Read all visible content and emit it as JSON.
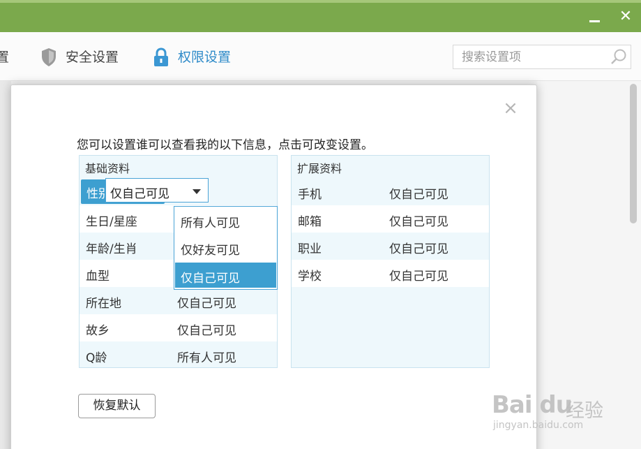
{
  "titlebar": {
    "minimize_icon": "minimize-icon",
    "close_glyph": "✕"
  },
  "nav": {
    "prev_tail": "置",
    "security_label": "安全设置",
    "permission_label": "权限设置",
    "security_icon": "shield-icon",
    "permission_icon": "lock-icon"
  },
  "search": {
    "placeholder": "搜索设置项",
    "icon": "search-icon"
  },
  "dialog": {
    "close_glyph": "×",
    "intro": "您可以设置谁可以查看我的以下信息，点击可改变设置。",
    "basic": {
      "title": "基础资料",
      "rows": [
        {
          "key": "性别",
          "value": "仅自己可见"
        },
        {
          "key": "生日/星座",
          "value": ""
        },
        {
          "key": "年龄/生肖",
          "value": ""
        },
        {
          "key": "血型",
          "value": ""
        },
        {
          "key": "所在地",
          "value": "仅自己可见"
        },
        {
          "key": "故乡",
          "value": "仅自己可见"
        },
        {
          "key": "Q龄",
          "value": "所有人可见"
        }
      ]
    },
    "select": {
      "current": "仅自己可见",
      "options": [
        "所有人可见",
        "仅好友可见",
        "仅自己可见"
      ],
      "selected_index": 2
    },
    "extended": {
      "title": "扩展资料",
      "rows": [
        {
          "key": "手机",
          "value": "仅自己可见"
        },
        {
          "key": "邮箱",
          "value": "仅自己可见"
        },
        {
          "key": "职业",
          "value": "仅自己可见"
        },
        {
          "key": "学校",
          "value": "仅自己可见"
        }
      ]
    },
    "restore_button": "恢复默认"
  },
  "watermark": {
    "brand": "Bai du",
    "label": "经验",
    "url": "jingyan.baidu.com"
  },
  "colors": {
    "titlebar_green": "#7ba94c",
    "accent_blue": "#3d9fd0",
    "panel_bg": "#eef8fc"
  }
}
